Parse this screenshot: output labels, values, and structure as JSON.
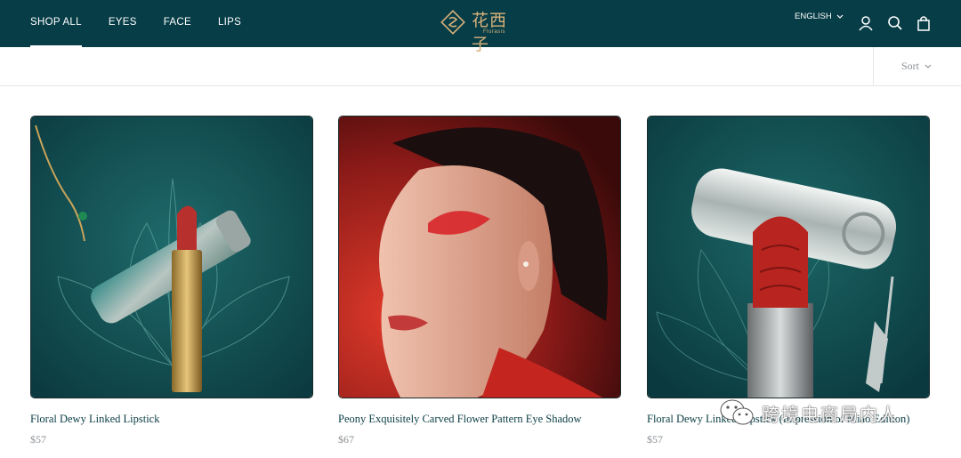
{
  "header": {
    "nav": [
      {
        "label": "SHOP ALL",
        "active": true
      },
      {
        "label": "EYES",
        "active": false
      },
      {
        "label": "FACE",
        "active": false
      },
      {
        "label": "LIPS",
        "active": false
      }
    ],
    "logo": {
      "cn": "花西子",
      "en": "Florasis",
      "color": "#d8b17a"
    },
    "language": "ENGLISH",
    "icons": [
      "account-icon",
      "search-icon",
      "cart-icon"
    ],
    "background_color": "#073d47"
  },
  "toolbar": {
    "sort_label": "Sort"
  },
  "products": [
    {
      "title": "Floral Dewy Linked Lipstick",
      "price": "$57",
      "image": "teal-lipstick-with-ornate-case"
    },
    {
      "title": "Peony Exquisitely Carved Flower Pattern Eye Shadow",
      "price": "$67",
      "image": "model-with-red-eye-makeup"
    },
    {
      "title": "Floral Dewy Linked Lipstick (Impression of Miao Edition)",
      "price": "$57",
      "image": "silver-lipstick-case-red-bullet"
    }
  ],
  "watermark": {
    "text": "跨境电商局内人",
    "icon": "wechat-icon"
  }
}
